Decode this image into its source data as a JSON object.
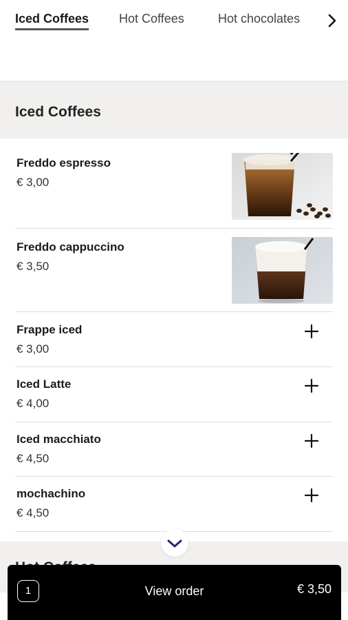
{
  "tabs": [
    "Iced Coffees",
    "Hot Coffees",
    "Hot chocolates"
  ],
  "sections": [
    {
      "title": "Iced Coffees",
      "items": [
        {
          "name": "Freddo espresso",
          "price": "€ 3,00"
        },
        {
          "name": "Freddo cappuccino",
          "price": "€ 3,50"
        },
        {
          "name": "Frappe iced",
          "price": "€ 3,00"
        },
        {
          "name": "Iced Latte",
          "price": "€ 4,00"
        },
        {
          "name": "Iced macchiato",
          "price": "€ 4,50"
        },
        {
          "name": "mochachino",
          "price": "€ 4,50"
        }
      ]
    },
    {
      "title": "Hot Coffees"
    }
  ],
  "order": {
    "count": "1",
    "label": "View order",
    "total": "€ 3,50"
  },
  "icons": {
    "tab_next": "chevron-right-icon",
    "add": "plus-icon",
    "scroll": "chevron-down-icon"
  },
  "colors": {
    "accent": "#1f2a6b",
    "section_bg": "#f1f0ee",
    "order_bar": "#000000"
  }
}
